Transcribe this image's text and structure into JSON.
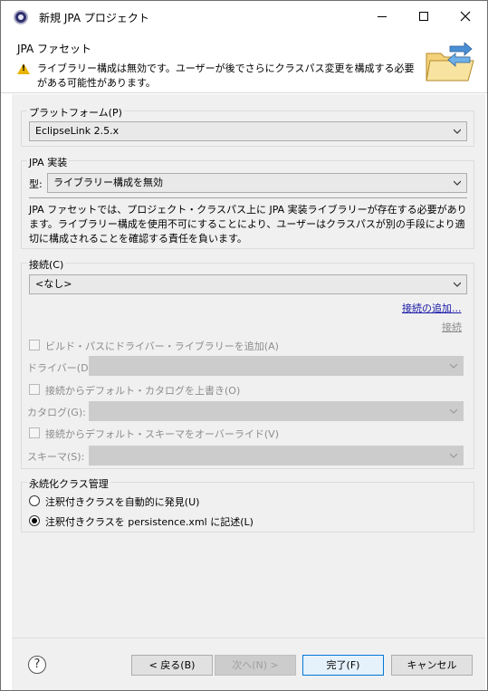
{
  "window": {
    "title": "新規 JPA プロジェクト"
  },
  "header": {
    "title": "JPA ファセット",
    "warning": "ライブラリー構成は無効です。ユーザーが後でさらにクラスパス変更を構成する必要がある可能性があります。"
  },
  "platform": {
    "label": "プラットフォーム(P)",
    "value": "EclipseLink 2.5.x"
  },
  "implementation": {
    "label": "JPA 実装",
    "type_label": "型:",
    "type_value": "ライブラリー構成を無効",
    "description": "JPA ファセットでは、プロジェクト・クラスパス上に JPA 実装ライブラリーが存在する必要があります。ライブラリー構成を使用不可にすることにより、ユーザーはクラスパスが別の手段により適切に構成されることを確認する責任を負います。"
  },
  "connection": {
    "label": "接続(C)",
    "value": "<なし>",
    "add_link": "接続の追加...",
    "connect_link": "接続",
    "driver_checkbox": "ビルド・パスにドライバー・ライブラリーを追加(A)",
    "driver_label": "ドライバー(D):",
    "catalog_checkbox": "接続からデフォルト・カタログを上書き(O)",
    "catalog_label": "カタログ(G):",
    "schema_checkbox": "接続からデフォルト・スキーマをオーバーライド(V)",
    "schema_label": "スキーマ(S):"
  },
  "persistence": {
    "label": "永続化クラス管理",
    "option_discover": "注釈付きクラスを自動的に発見(U)",
    "option_list": "注釈付きクラスを persistence.xml に記述(L)"
  },
  "footer": {
    "help_icon": "?",
    "back": "< 戻る(B)",
    "next": "次へ(N) >",
    "finish": "完了(F)",
    "cancel": "キャンセル"
  },
  "icons": {
    "app": "eclipse-icon",
    "warning": "warning-icon",
    "wizard": "folder-arrows-icon"
  },
  "colors": {
    "link": "#1a1aa6",
    "warning": "#e8b400",
    "panel": "#f0f0f0"
  }
}
